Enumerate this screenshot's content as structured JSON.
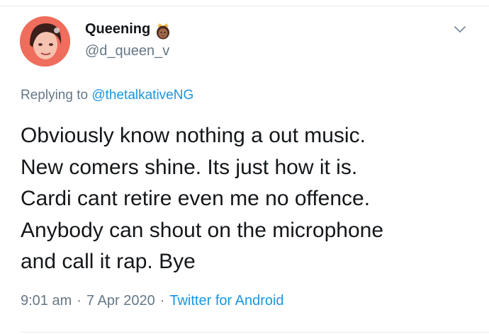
{
  "tweet": {
    "author": {
      "display_name": "Queening",
      "name_emoji": "crown-woman-emoji",
      "handle": "@d_queen_v",
      "avatar": "profile-photo-avatar"
    },
    "menu_icon": "chevron-down-icon",
    "replying_prefix": "Replying to",
    "replying_to": "@thetalkativeNG",
    "body_lines": [
      "Obviously know nothing a out music.",
      "New comers shine. Its just how it is.",
      "Cardi cant retire even me no offence.",
      "Anybody can shout on the microphone",
      "and call it rap. Bye"
    ],
    "time": "9:01 am",
    "separator": "·",
    "date": "7 Apr 2020",
    "separator2": "·",
    "source": "Twitter for Android"
  },
  "colors": {
    "text": "#14171a",
    "secondary": "#657786",
    "link": "#1b95e0",
    "divider": "#e6ecf0"
  }
}
